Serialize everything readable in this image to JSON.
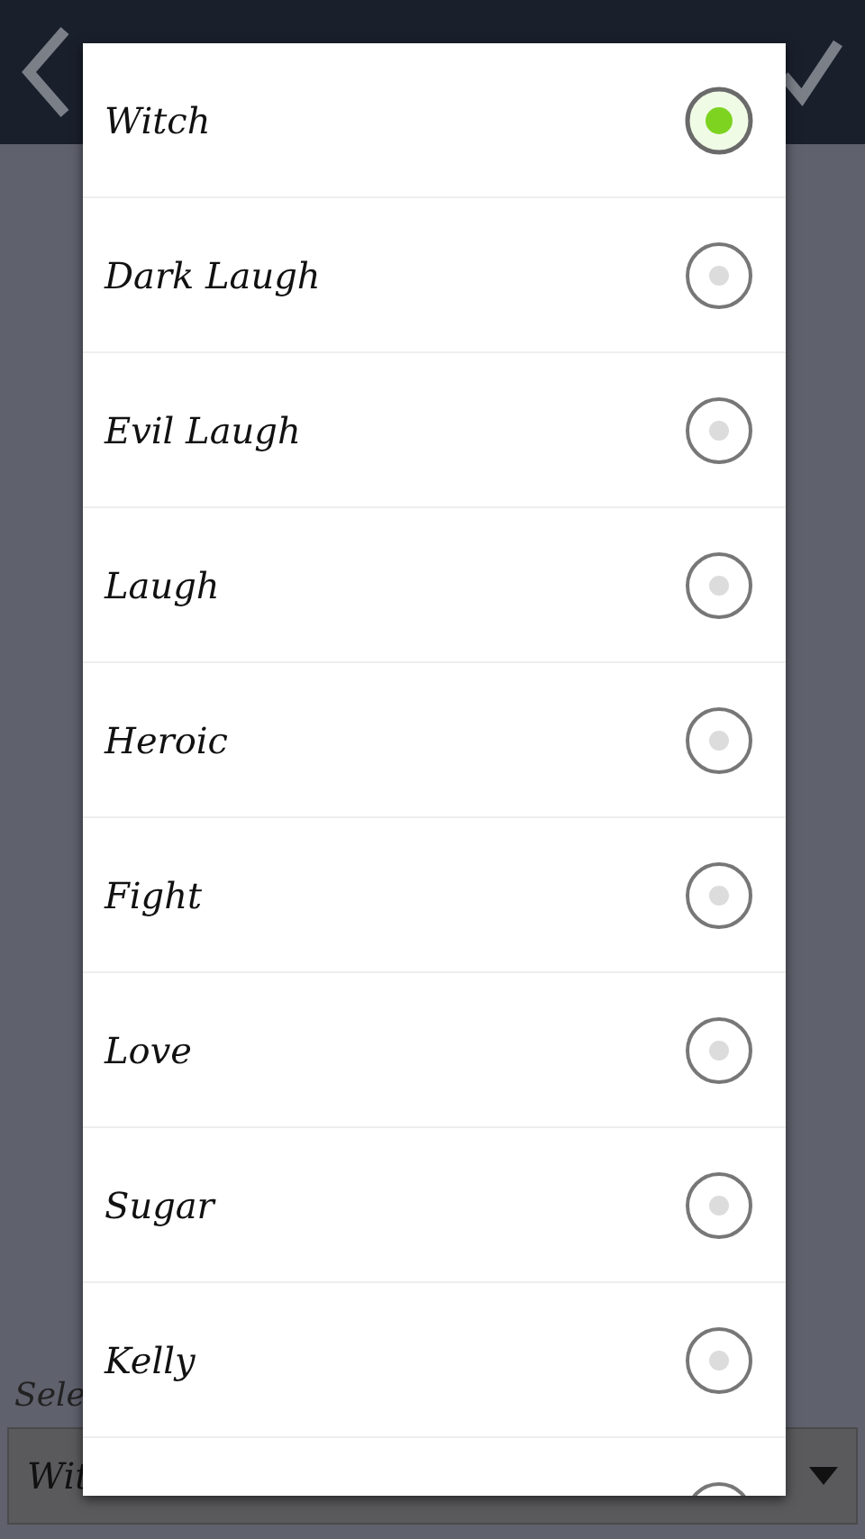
{
  "background_screen": {
    "field_label": "Sele",
    "dropdown": {
      "value": "Wit"
    }
  },
  "dialog": {
    "options": [
      {
        "label": "Witch",
        "selected": true
      },
      {
        "label": "Dark Laugh",
        "selected": false
      },
      {
        "label": "Evil Laugh",
        "selected": false
      },
      {
        "label": "Laugh",
        "selected": false
      },
      {
        "label": "Heroic",
        "selected": false
      },
      {
        "label": "Fight",
        "selected": false
      },
      {
        "label": "Love",
        "selected": false
      },
      {
        "label": "Sugar",
        "selected": false
      },
      {
        "label": "Kelly",
        "selected": false
      },
      {
        "selected": false
      }
    ]
  }
}
